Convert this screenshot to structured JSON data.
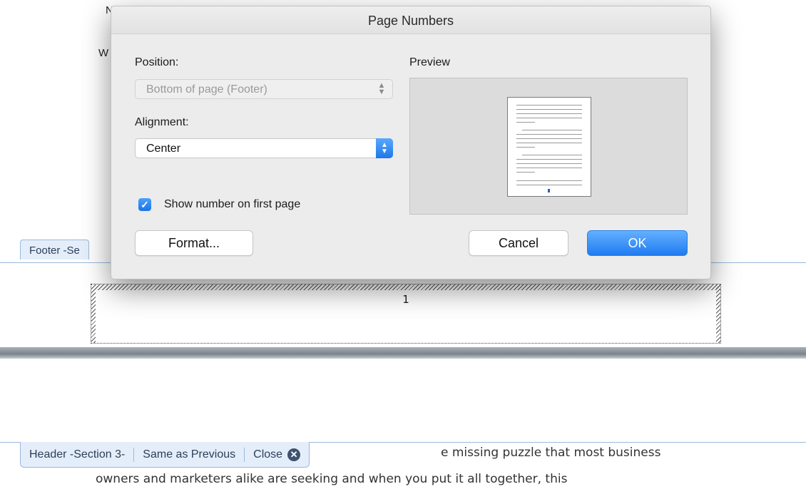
{
  "document": {
    "partial_text_1": "N",
    "partial_text_2": "W",
    "footer_tab_label": "Footer -Se",
    "footer_page_number": "1",
    "body_line_1": "e missing puzzle that most business",
    "body_line_2": "owners and marketers alike are seeking and when you put it all together, this",
    "header_tab": {
      "section_label": "Header -Section 3-",
      "same_as_previous": "Same as Previous",
      "close_label": "Close",
      "close_icon": "close-circle-icon"
    }
  },
  "dialog": {
    "title": "Page Numbers",
    "position_label": "Position:",
    "position_value": "Bottom of page (Footer)",
    "alignment_label": "Alignment:",
    "alignment_value": "Center",
    "preview_label": "Preview",
    "show_number_label": "Show number on first page",
    "show_number_checked": true,
    "format_button": "Format...",
    "cancel_button": "Cancel",
    "ok_button": "OK"
  },
  "colors": {
    "accent": "#1f7bf0",
    "section_tab_bg": "#e4eefa",
    "section_border": "#9bb8dc"
  }
}
